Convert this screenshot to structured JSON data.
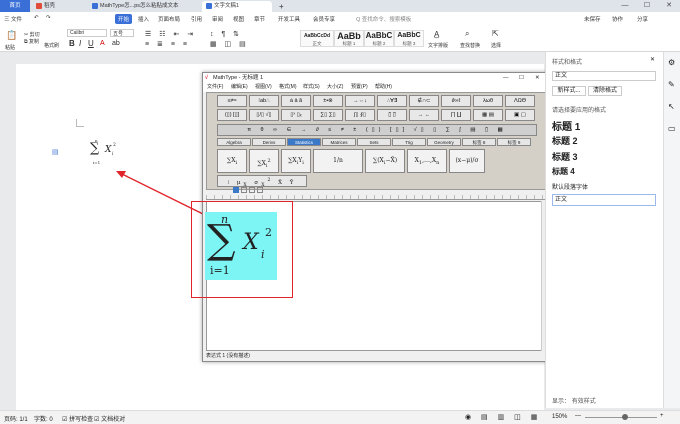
{
  "titlebar": {
    "tabs": [
      {
        "label": "首页"
      },
      {
        "label": "稻壳"
      },
      {
        "label": "MathType怎...ps怎么粘贴成文本"
      },
      {
        "label": "文字文稿1"
      }
    ],
    "add_tab": "+",
    "window_buttons": [
      "—",
      "☐",
      "✕"
    ]
  },
  "menubar": {
    "items": [
      "三 文件",
      "开始",
      "插入",
      "页面布局",
      "引用",
      "审阅",
      "视图",
      "章节",
      "开发工具",
      "会员专享"
    ],
    "search_placeholder": "Q 查找命令、搜索模板",
    "right_items": [
      "未保存",
      "协作",
      "分享"
    ]
  },
  "ribbon": {
    "paste": "粘贴",
    "cut": "剪切",
    "copy": "复制",
    "format_painter": "格式刷",
    "font": "Calibri",
    "size": "五号",
    "styles": [
      {
        "preview": "AaBbCcDd",
        "label": "正文"
      },
      {
        "preview": "AaBb",
        "label": "标题 1"
      },
      {
        "preview": "AaBbC",
        "label": "标题 2"
      },
      {
        "preview": "AaBbC",
        "label": "标题 3"
      }
    ],
    "text_layout": "文字排版",
    "find_replace": "查找替换",
    "select": "选择"
  },
  "document": {
    "formula": {
      "sum": "∑",
      "upper": "n",
      "lower": "i=1",
      "var": "X",
      "sub": "i",
      "sup": "2"
    }
  },
  "mathtype": {
    "title": "MathType - 无标题 1",
    "menu": [
      "文件(F)",
      "编辑(E)",
      "视图(V)",
      "格式(M)",
      "样式(S)",
      "大小(Z)",
      "预置(P)",
      "帮助(H)"
    ],
    "tabs": [
      "Algebra",
      "Derivs",
      "Statistics",
      "Matrices",
      "Sets",
      "Trig",
      "Geometry",
      "标签 8",
      "标签 9"
    ],
    "selected_tab": "Statistics",
    "status": "表达式 1   (没有描述)"
  },
  "rpanel": {
    "title": "样式和格式",
    "current_style": "正文",
    "new_style": "新样式...",
    "clear_format": "清除格式",
    "apply_label": "请选择要应用的格式",
    "styles": [
      "标题 1",
      "标题 2",
      "标题 3",
      "标题 4"
    ],
    "default_font": "默认段落字体",
    "body": "正文",
    "show_label": "显示：",
    "show_value": "有效样式"
  },
  "status": {
    "page": "页码: 1/1",
    "words": "字数: 0",
    "spell": "拼写检查",
    "doc_check": "文档校对",
    "zoom": "150%"
  },
  "colors": {
    "accent": "#3a6fd8",
    "highlight": "#7ef5f5",
    "red": "#e0242a"
  }
}
